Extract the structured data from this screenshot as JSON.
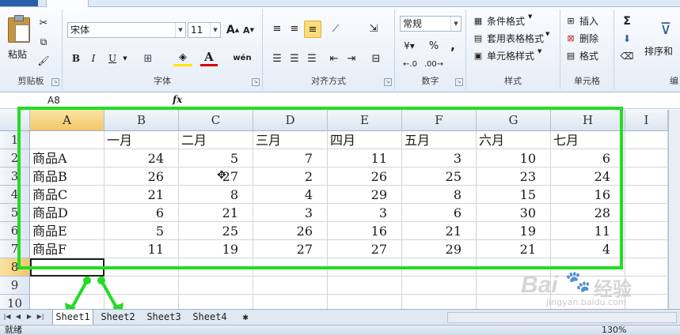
{
  "ribbon": {
    "clipboard": {
      "title": "剪贴板",
      "paste": "粘贴"
    },
    "font": {
      "title": "字体",
      "name": "宋体",
      "size": "11",
      "bold": "B",
      "italic": "I",
      "underline": "U",
      "font_color_letter": "A",
      "phonetic": "wén"
    },
    "alignment": {
      "title": "对齐方式"
    },
    "number": {
      "title": "数字",
      "format": "常规",
      "percent": "%",
      "comma": ","
    },
    "styles": {
      "title": "样式",
      "conditional": "条件格式",
      "table": "套用表格格式",
      "cell_styles": "单元格样式"
    },
    "cells": {
      "title": "单元格",
      "insert": "插入",
      "delete": "删除",
      "format": "格式"
    },
    "editing": {
      "sigma": "Σ",
      "sort": "排序和",
      "title_partial": "编"
    }
  },
  "formula_bar": {
    "name_box": "A8",
    "fx": "fx"
  },
  "columns": [
    "A",
    "B",
    "C",
    "D",
    "E",
    "F",
    "G",
    "H",
    "I"
  ],
  "rows": [
    "1",
    "2",
    "3",
    "4",
    "5",
    "6",
    "7",
    "8",
    "9",
    "10"
  ],
  "table": {
    "header": [
      "",
      "一月",
      "二月",
      "三月",
      "四月",
      "五月",
      "六月",
      "七月"
    ],
    "data": [
      {
        "name": "商品A",
        "values": [
          24,
          5,
          7,
          11,
          3,
          10,
          6
        ]
      },
      {
        "name": "商品B",
        "values": [
          26,
          27,
          2,
          26,
          25,
          23,
          24
        ]
      },
      {
        "name": "商品C",
        "values": [
          21,
          8,
          4,
          29,
          8,
          15,
          16
        ]
      },
      {
        "name": "商品D",
        "values": [
          6,
          21,
          3,
          3,
          6,
          30,
          28
        ]
      },
      {
        "name": "商品E",
        "values": [
          5,
          25,
          26,
          16,
          21,
          19,
          11
        ]
      },
      {
        "name": "商品F",
        "values": [
          11,
          19,
          27,
          27,
          29,
          21,
          4
        ]
      }
    ]
  },
  "sheets": [
    "Sheet1",
    "Sheet2",
    "Sheet3",
    "Sheet4"
  ],
  "active_sheet": "Sheet1",
  "status": {
    "ready": "就绪",
    "zoom": "130%"
  },
  "watermark": {
    "brand": "Bai",
    "brand2": "经验",
    "url": "jingyan.baidu.com"
  },
  "colors": {
    "annotation": "#22dd22",
    "selection_header": "#f3c766"
  }
}
